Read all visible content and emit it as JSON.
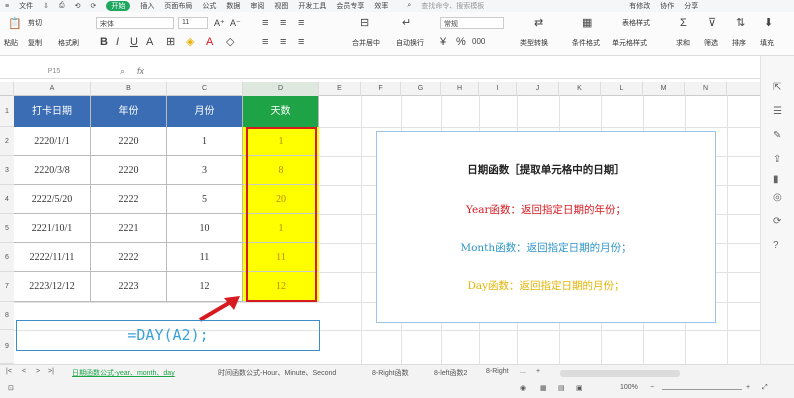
{
  "menubar": {
    "items": [
      "文件",
      "开始",
      "插入",
      "页面布局",
      "公式",
      "数据",
      "审阅",
      "视图",
      "开发工具",
      "会员专享",
      "效率"
    ],
    "active_index": 1,
    "leading": [
      "≡",
      "文件",
      "⇩",
      "⎙",
      "⟲",
      "⟳",
      "▾"
    ],
    "search_placeholder": "查找命令、搜索模板",
    "right": [
      "有修改",
      "协作",
      "分享"
    ]
  },
  "ribbon": {
    "paste": "粘贴",
    "cut": "剪切",
    "copy": "复制",
    "format_painter": "格式刷",
    "font_name": "宋体",
    "font_size": "11",
    "align_general": "常规",
    "merge": "合并居中",
    "wrap": "自动换行",
    "convert": "类型转换",
    "cond_format": "条件格式",
    "cell_style": "单元格样式",
    "table_style": "表格样式",
    "sum": "求和",
    "filter": "筛选",
    "sort": "排序",
    "fill": "填充"
  },
  "namebox": {
    "value": "P15"
  },
  "fx": {
    "label": "fx"
  },
  "columns": [
    "A",
    "B",
    "C",
    "D",
    "E",
    "F",
    "G",
    "H",
    "I",
    "J",
    "K",
    "L",
    "M",
    "N"
  ],
  "rows": [
    "1",
    "2",
    "3",
    "4",
    "5",
    "6",
    "7",
    "8",
    "9"
  ],
  "table": {
    "headers": [
      "打卡日期",
      "年份",
      "月份",
      "天数"
    ],
    "rows": [
      [
        "2220/1/1",
        "2220",
        "1",
        "1"
      ],
      [
        "2220/3/8",
        "2220",
        "3",
        "8"
      ],
      [
        "2222/5/20",
        "2222",
        "5",
        "20"
      ],
      [
        "2221/10/1",
        "2221",
        "10",
        "1"
      ],
      [
        "2222/11/11",
        "2222",
        "11",
        "11"
      ],
      [
        "2223/12/12",
        "2223",
        "12",
        "12"
      ]
    ]
  },
  "formula_text": "=DAY(A2);",
  "info": {
    "title": "日期函数［提取单元格中的日期］",
    "year": "Year函数：返回指定日期的年份；",
    "month": "Month函数：返回指定日期的月份；",
    "day": "Day函数：返回指定日期的月份；"
  },
  "colors": {
    "header_blue": "#3b6db4",
    "highlight_yellow": "#ffff00",
    "red": "#d71920",
    "year_red": "#d71920",
    "month_blue": "#2f95c9",
    "day_gold": "#e3b400"
  },
  "sheet_tabs": [
    "日期函数公式-year、month、day",
    "时间函数公式-Hour、Minute、Second",
    "8-Right函数",
    "8-left函数2",
    "8-Right"
  ],
  "active_tab": 0,
  "status": {
    "zoom": "100%"
  }
}
